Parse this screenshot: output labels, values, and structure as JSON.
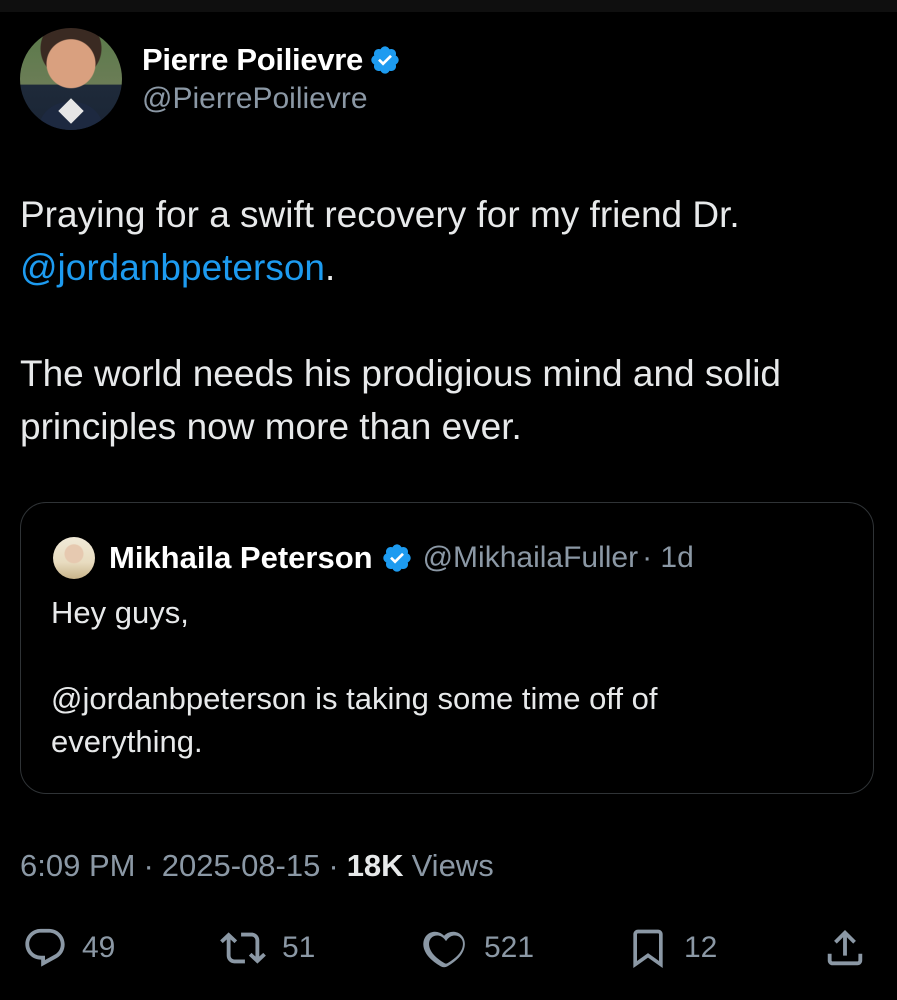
{
  "author": {
    "name": "Pierre Poilievre",
    "handle": "@PierrePoilievre"
  },
  "tweet": {
    "line1": "Praying for a swift recovery for my friend Dr.",
    "mention": "@jordanbpeterson",
    "mention_suffix": ".",
    "paragraph2_line1": "The world needs his prodigious mind and solid",
    "paragraph2_line2": "principles now more than ever."
  },
  "quote": {
    "name": "Mikhaila Peterson",
    "handle": "@MikhailaFuller",
    "time": "· 1d",
    "line1": "Hey guys,",
    "line2": "@jordanbpeterson is taking some time off of",
    "line3": "everything."
  },
  "meta": {
    "time": "6:09 PM",
    "date": "2025-08-15",
    "views_count": "18K",
    "views_label": "Views"
  },
  "actions": {
    "replies": "49",
    "reposts": "51",
    "likes": "521",
    "bookmarks": "12"
  },
  "colors": {
    "accent": "#1d9bf0",
    "muted": "#8b98a5",
    "background": "#000000"
  }
}
